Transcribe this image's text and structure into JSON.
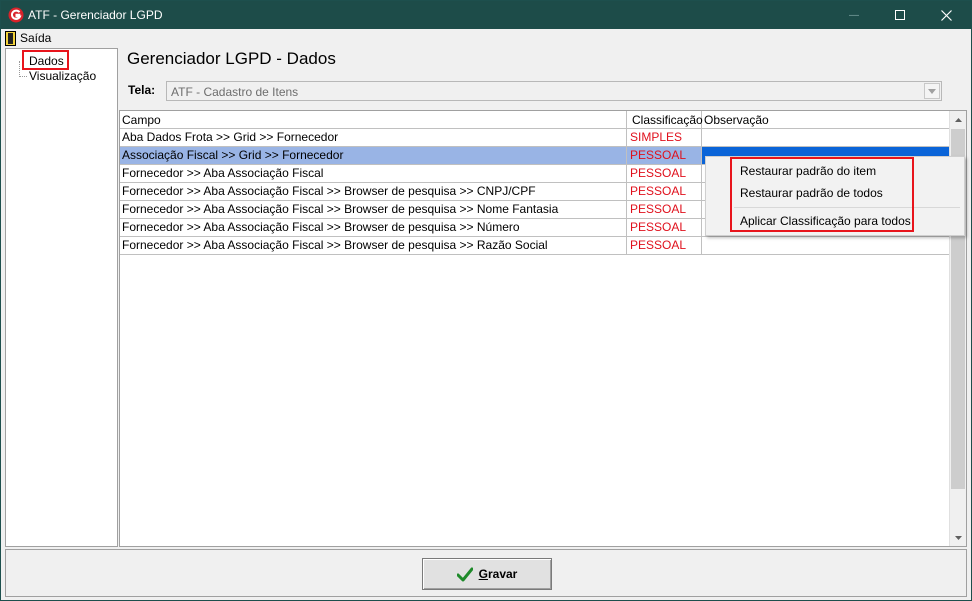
{
  "window": {
    "title": "ATF - Gerenciador LGPD",
    "minimize_glyph": "—",
    "maximize_glyph": "☐",
    "close_glyph": "✕"
  },
  "menu": {
    "items": [
      {
        "label": "Saída",
        "icon": "exit-door-icon"
      }
    ]
  },
  "sidebar": {
    "items": [
      {
        "label": "Dados",
        "selected": true
      },
      {
        "label": "Visualização",
        "selected": false
      }
    ]
  },
  "main": {
    "title": "Gerenciador LGPD - Dados",
    "tela_label": "Tela:",
    "tela_value": "ATF - Cadastro de Itens"
  },
  "grid": {
    "columns": [
      "Campo",
      "Classificação",
      "Observação"
    ],
    "rows": [
      {
        "campo": "Aba Dados Frota >> Grid >> Fornecedor",
        "classificacao": "SIMPLES",
        "observacao": ""
      },
      {
        "campo": "Associação Fiscal >> Grid >> Fornecedor",
        "classificacao": "PESSOAL",
        "observacao": ""
      },
      {
        "campo": "Fornecedor >> Aba Associação Fiscal",
        "classificacao": "PESSOAL",
        "observacao": ""
      },
      {
        "campo": "Fornecedor >> Aba Associação Fiscal >> Browser de pesquisa >> CNPJ/CPF",
        "classificacao": "PESSOAL",
        "observacao": ""
      },
      {
        "campo": "Fornecedor >> Aba Associação Fiscal >> Browser de pesquisa >> Nome Fantasia",
        "classificacao": "PESSOAL",
        "observacao": ""
      },
      {
        "campo": "Fornecedor >> Aba Associação Fiscal >> Browser de pesquisa >> Número",
        "classificacao": "PESSOAL",
        "observacao": ""
      },
      {
        "campo": "Fornecedor >> Aba Associação Fiscal >> Browser de pesquisa >> Razão Social",
        "classificacao": "PESSOAL",
        "observacao": ""
      }
    ],
    "selected_row": 1
  },
  "context_menu": {
    "items": [
      "Restaurar padrão do item",
      "Restaurar padrão de todos",
      "Aplicar Classificação para todos"
    ]
  },
  "footer": {
    "save_label_underlined": "G",
    "save_label_rest": "ravar"
  },
  "colors": {
    "titlebar": "#1d4c49",
    "classification_text": "#e0101c",
    "selected_row": "#99b4e5",
    "selected_cell": "#0a64d8",
    "annotation_box": "#e8141c"
  }
}
